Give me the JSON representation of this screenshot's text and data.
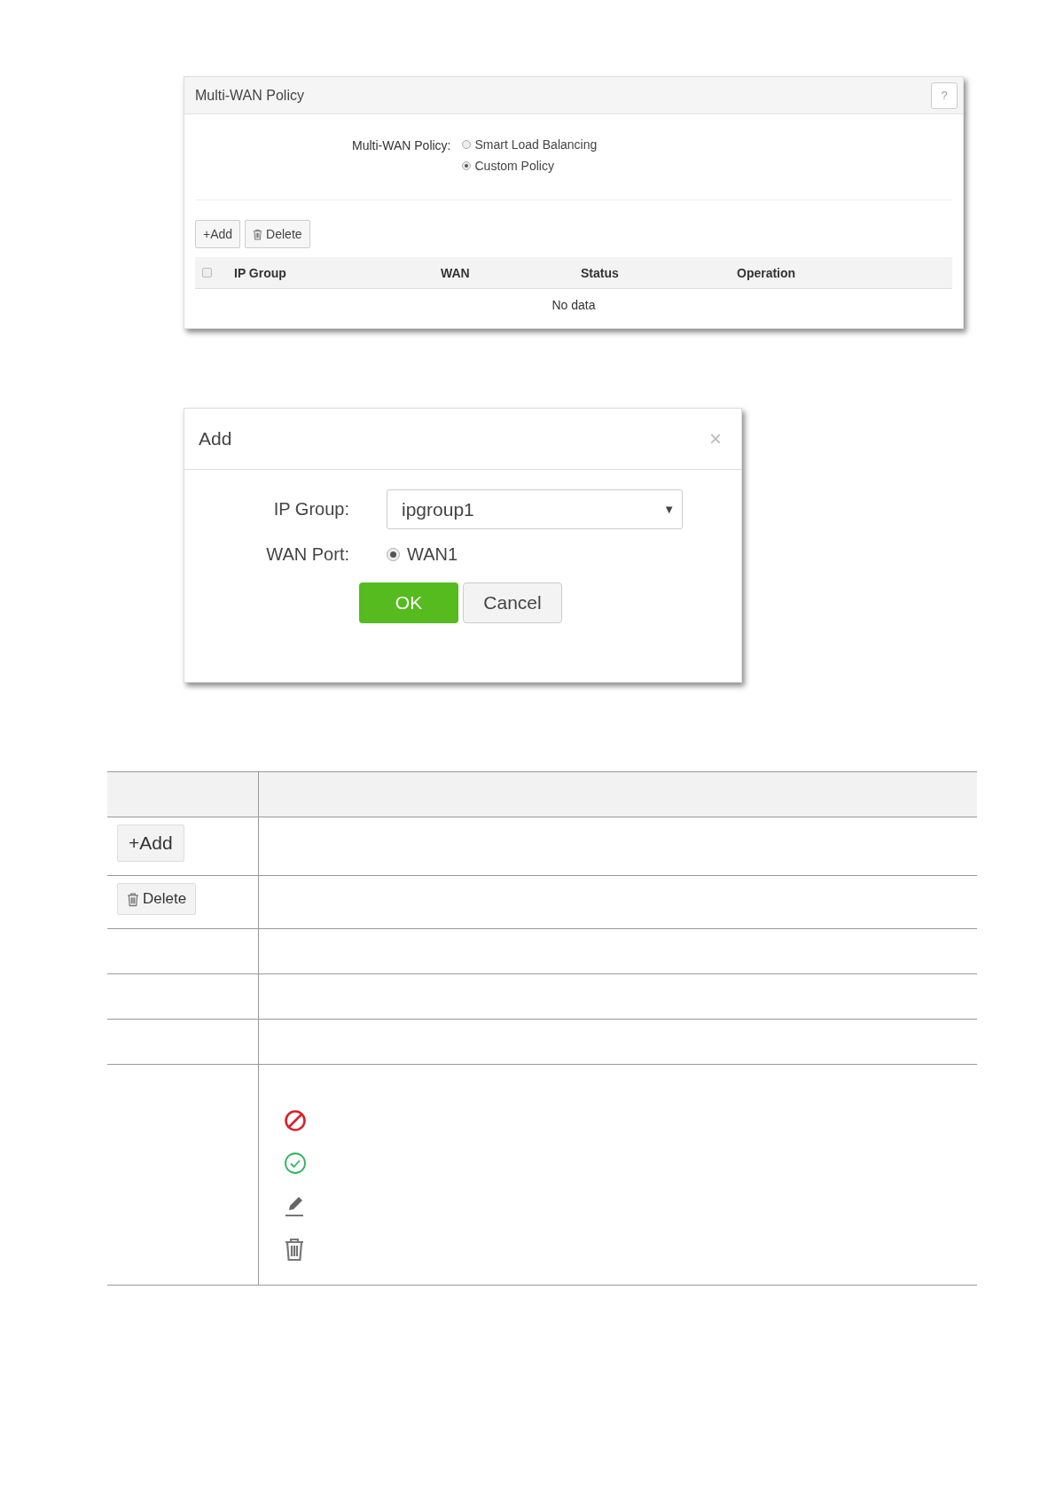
{
  "policy_panel": {
    "title": "Multi-WAN Policy",
    "help": "?",
    "policy_label": "Multi-WAN Policy:",
    "options": [
      {
        "label": "Smart Load Balancing",
        "selected": false
      },
      {
        "label": "Custom Policy",
        "selected": true
      }
    ],
    "add_button": "+Add",
    "delete_button": "Delete",
    "table": {
      "select_all_checked": false,
      "columns": [
        "IP Group",
        "WAN",
        "Status",
        "Operation"
      ],
      "empty_text": "No data"
    }
  },
  "add_dialog": {
    "title": "Add",
    "close": "×",
    "ip_group_label": "IP Group:",
    "ip_group_value": "ipgroup1",
    "dropdown_arrow": "▼",
    "wan_port_label": "WAN Port:",
    "wan_options": [
      {
        "label": "WAN1",
        "selected": true
      }
    ],
    "ok_button": "OK",
    "cancel_button": "Cancel"
  },
  "legend_table": {
    "rows": [
      {
        "kind": "blank",
        "header": true
      },
      {
        "kind": "button",
        "label": "+Add"
      },
      {
        "kind": "trash_button",
        "label": "Delete"
      },
      {
        "kind": "blank"
      },
      {
        "kind": "blank"
      },
      {
        "kind": "blank"
      },
      {
        "kind": "operation_icons"
      }
    ]
  }
}
